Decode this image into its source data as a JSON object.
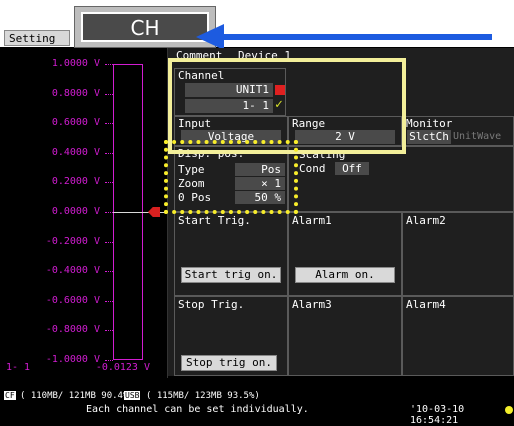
{
  "header": {
    "setting_tab": "Setting",
    "ch_label": "CH"
  },
  "comment": {
    "label": "Comment",
    "value": "Device 1"
  },
  "scale": {
    "labels": [
      "1.0000 V",
      "0.8000 V",
      "0.6000 V",
      "0.4000 V",
      "0.2000 V",
      "0.0000 V",
      "-0.2000 V",
      "-0.4000 V",
      "-0.6000 V",
      "-0.8000 V",
      "-1.0000 V"
    ],
    "channel": "1- 1",
    "current_value": "-0.0123 V"
  },
  "channel": {
    "label": "Channel",
    "unit": "UNIT1",
    "number": "1- 1",
    "check": "✓"
  },
  "input": {
    "label": "Input",
    "value": "Voltage"
  },
  "range": {
    "label": "Range",
    "value": "2 V"
  },
  "monitor": {
    "label": "Monitor",
    "select": "SlctCh",
    "unitwave": "UnitWave"
  },
  "display_pos": {
    "label": "Disp. pos.",
    "type_label": "Type",
    "type_value": "Pos",
    "zoom_label": "Zoom",
    "zoom_value": "× 1",
    "pos_label": "0 Pos",
    "pos_value": "50 %"
  },
  "scaling": {
    "label": "Scaling",
    "cond_label": "Cond",
    "cond_value": "Off"
  },
  "triggers": {
    "start_label": "Start Trig.",
    "start_button": "Start trig on.",
    "stop_label": "Stop Trig.",
    "stop_button": "Stop trig on."
  },
  "alarms": {
    "alarm1": "Alarm1",
    "alarm2": "Alarm2",
    "alarm3": "Alarm3",
    "alarm4": "Alarm4",
    "alarm_button": "Alarm on."
  },
  "status": {
    "cf_label": "CF",
    "cf_info": "( 110MB/ 121MB 90.4%)",
    "usb_label": "USB",
    "usb_info": "( 115MB/ 123MB 93.5%)",
    "message": "Each channel can be set individually.",
    "datetime": "'10-03-10 16:54:21"
  }
}
